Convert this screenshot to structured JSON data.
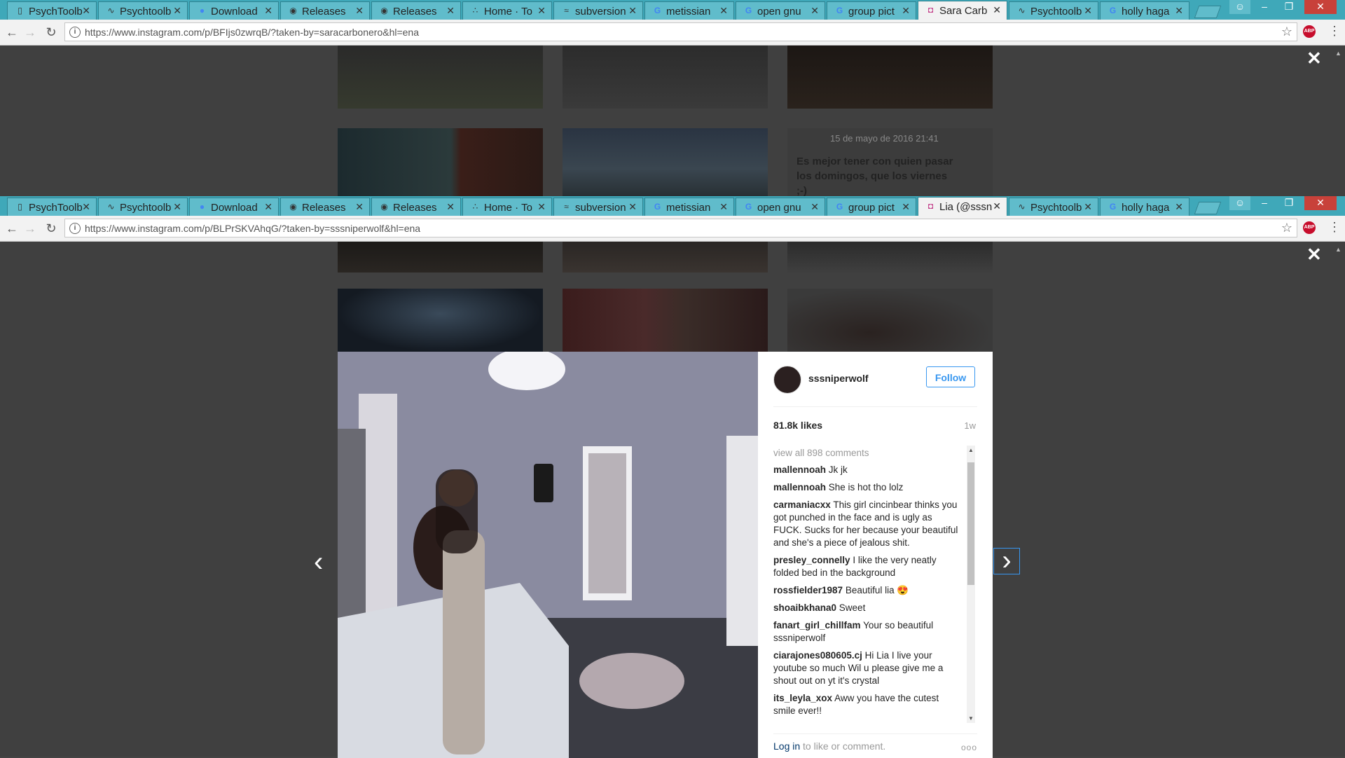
{
  "windows": [
    {
      "tabs": [
        {
          "label": "PsychToolb",
          "icon": "page-icon"
        },
        {
          "label": "Psychtoolb",
          "icon": "wave-icon"
        },
        {
          "label": "Download",
          "icon": "dot-icon"
        },
        {
          "label": "Releases",
          "icon": "github-icon"
        },
        {
          "label": "Releases",
          "icon": "github-icon"
        },
        {
          "label": "Home · To",
          "icon": "brand-icon"
        },
        {
          "label": "subversion",
          "icon": "svn-icon"
        },
        {
          "label": "metissian",
          "icon": "google-icon"
        },
        {
          "label": "open gnu",
          "icon": "google-icon"
        },
        {
          "label": "group pict",
          "icon": "google-icon"
        },
        {
          "label": "Sara Carb",
          "icon": "instagram-icon"
        },
        {
          "label": "Psychtoolb",
          "icon": "wave-icon"
        },
        {
          "label": "holly haga",
          "icon": "google-icon"
        }
      ],
      "url": "https://www.instagram.com/p/BFIjs0zwrqB/?taken-by=saracarbonero&hl=ena",
      "post_date": "15 de mayo de 2016 21:41",
      "caption": "Es mejor tener con quien pasar los domingos, que los viernes ;-)"
    },
    {
      "tabs": [
        {
          "label": "PsychToolb",
          "icon": "page-icon"
        },
        {
          "label": "Psychtoolb",
          "icon": "wave-icon"
        },
        {
          "label": "Download",
          "icon": "dot-icon"
        },
        {
          "label": "Releases",
          "icon": "github-icon"
        },
        {
          "label": "Releases",
          "icon": "github-icon"
        },
        {
          "label": "Home · To",
          "icon": "brand-icon"
        },
        {
          "label": "subversion",
          "icon": "svn-icon"
        },
        {
          "label": "metissian",
          "icon": "google-icon"
        },
        {
          "label": "open gnu",
          "icon": "google-icon"
        },
        {
          "label": "group pict",
          "icon": "google-icon"
        },
        {
          "label": "Lia (@sssn",
          "icon": "instagram-icon"
        },
        {
          "label": "Psychtoolb",
          "icon": "wave-icon"
        },
        {
          "label": "holly haga",
          "icon": "google-icon"
        }
      ],
      "url": "https://www.instagram.com/p/BLPrSKVAhqG/?taken-by=sssniperwolf&hl=ena"
    }
  ],
  "active_tab_index": 10,
  "post": {
    "username": "sssniperwolf",
    "follow_label": "Follow",
    "likes": "81.8k likes",
    "age": "1w",
    "view_all": "view all 898 comments",
    "comments": [
      {
        "user": "mallennoah",
        "text": "Jk jk"
      },
      {
        "user": "mallennoah",
        "text": "She is hot tho lolz"
      },
      {
        "user": "carmaniacxx",
        "text": "This girl cincinbear thinks you got punched in the face and is ugly as FUCK. Sucks for her because your beautiful and she's a piece of jealous shit."
      },
      {
        "user": "presley_connelly",
        "text": "I like the very neatly folded bed in the background"
      },
      {
        "user": "rossfielder1987",
        "text": "Beautiful lia 😍"
      },
      {
        "user": "shoaibkhana0",
        "text": "Sweet"
      },
      {
        "user": "fanart_girl_chillfam",
        "text": "Your so beautiful sssniperwolf"
      },
      {
        "user": "ciarajones080605.cj",
        "text": "Hi Lia I live your youtube so much Wil u please give me a shout out on yt it's crystal"
      },
      {
        "user": "its_leyla_xox",
        "text": "Aww you have the cutest smile ever!!"
      }
    ],
    "login_link": "Log in",
    "login_text": " to like or comment.",
    "more": "ooo"
  },
  "colors": {
    "tabstrip": "#3fa8b9",
    "instagram_blue": "#3897f0",
    "close_red": "#c8413a"
  }
}
